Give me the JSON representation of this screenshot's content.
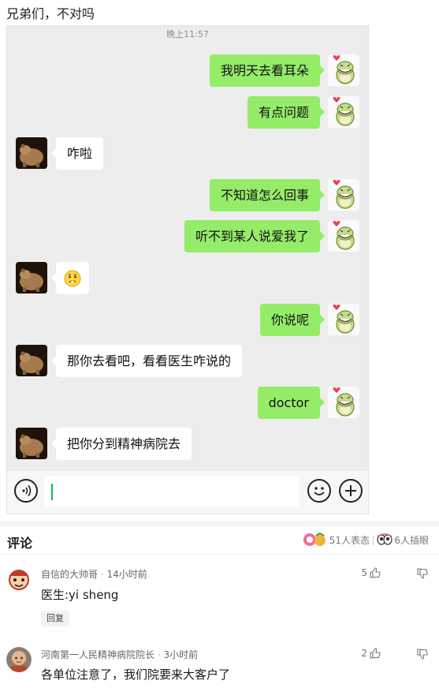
{
  "post": {
    "title": "兄弟们，不对吗"
  },
  "chat": {
    "timestamp": "晚上11:57",
    "messages": [
      {
        "side": "me",
        "text": "我明天去看耳朵"
      },
      {
        "side": "me",
        "text": "有点问题"
      },
      {
        "side": "them",
        "text": "咋啦"
      },
      {
        "side": "me",
        "text": "不知道怎么回事"
      },
      {
        "side": "me",
        "text": "听不到某人说爱我了"
      },
      {
        "side": "them",
        "text": "",
        "emoji": "confused-emoji"
      },
      {
        "side": "me",
        "text": "你说呢"
      },
      {
        "side": "them",
        "text": "那你去看吧，看看医生咋说的"
      },
      {
        "side": "me",
        "text": "doctor"
      },
      {
        "side": "them",
        "text": "把你分到精神病院去"
      }
    ],
    "input": {
      "value": ""
    }
  },
  "comments": {
    "title": "评论",
    "reactions": "51人表态",
    "peeks": "6人插眼",
    "items": [
      {
        "author": "自信的大帅哥",
        "time": "14小时前",
        "text": "医生:yi sheng",
        "likes": "5",
        "reply_label": "回复"
      },
      {
        "author": "河南第一人民精神病院院长",
        "time": "3小时前",
        "text": "各单位注意了，我们院要来大客户了",
        "likes": "2"
      }
    ]
  },
  "colors": {
    "my_bubble": "#95ec69",
    "their_bubble": "#ffffff",
    "chat_bg": "#ededed",
    "caret": "#07c160"
  }
}
